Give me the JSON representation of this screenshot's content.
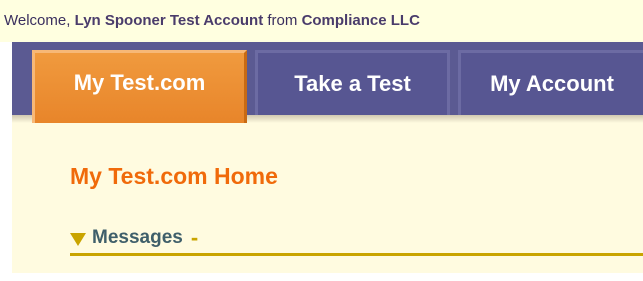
{
  "welcome": {
    "prefix": "Welcome,",
    "user": "Lyn Spooner Test Account",
    "from": "from",
    "company": "Compliance LLC"
  },
  "nav": {
    "tabs": [
      {
        "label": "My Test.com",
        "active": true
      },
      {
        "label": "Take a Test",
        "active": false
      },
      {
        "label": "My Account",
        "active": false
      }
    ]
  },
  "main": {
    "title": "My Test.com Home",
    "messages": {
      "label": "Messages",
      "toggle": "-",
      "icon": "triangle-down-icon"
    }
  },
  "colors": {
    "accent_orange": "#f06a0a",
    "nav_purple": "#5b5a92",
    "rule_gold": "#c9a400",
    "content_bg": "#fffbe0"
  }
}
